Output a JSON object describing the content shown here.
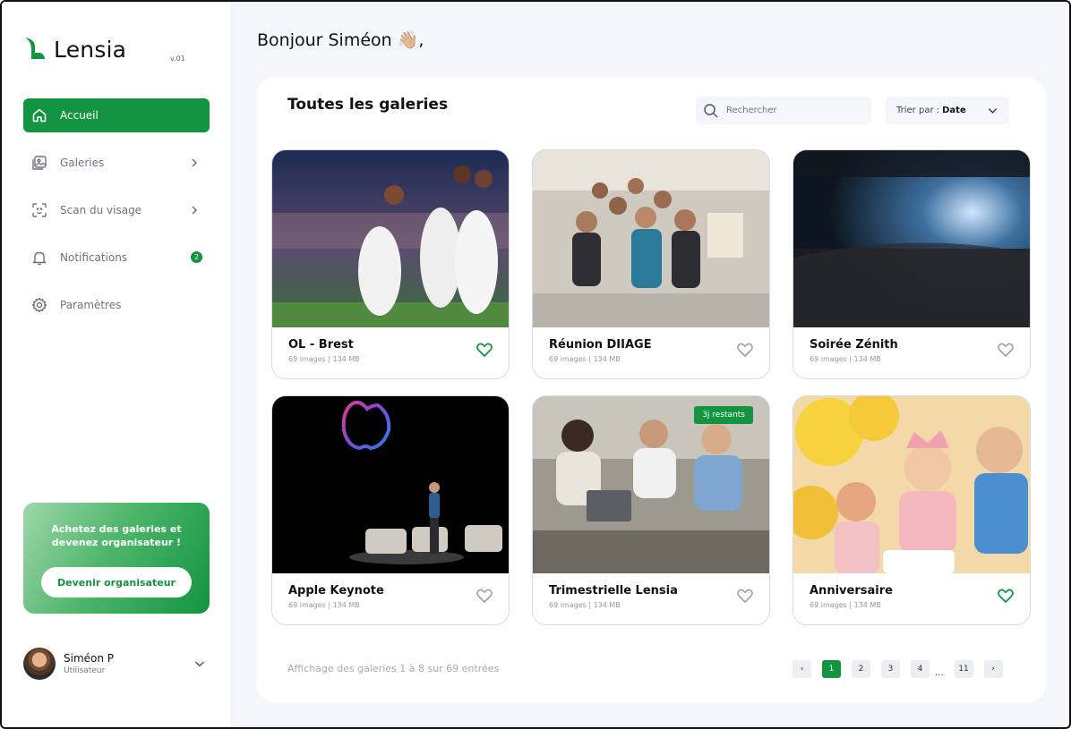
{
  "brand": {
    "name": "Lensia",
    "version": "v.01",
    "accent": "#129440"
  },
  "sidebar": {
    "items": [
      {
        "label": "Accueil",
        "icon": "home-icon",
        "active": true
      },
      {
        "label": "Galeries",
        "icon": "gallery-icon"
      },
      {
        "label": "Scan du visage",
        "icon": "face-scan-icon"
      },
      {
        "label": "Notifications",
        "icon": "bell-icon",
        "badge": "2"
      },
      {
        "label": "Paramètres",
        "icon": "gear-icon"
      }
    ],
    "promo": {
      "text": "Achetez des galeries et devenez organisateur !",
      "button": "Devenir organisateur"
    },
    "user": {
      "name": "Siméon P",
      "role": "Utilisateur"
    }
  },
  "header": {
    "greeting": "Bonjour Siméon 👋🏼,"
  },
  "main": {
    "title": "Toutes les galeries",
    "search": {
      "placeholder": "Rechercher"
    },
    "sort": {
      "label": "Trier par :",
      "value": "Date"
    },
    "galleries": [
      {
        "title": "OL - Brest",
        "meta": "69 images | 134 MB",
        "favorite": true
      },
      {
        "title": "Réunion DIIAGE",
        "meta": "69 images | 134 MB",
        "favorite": false
      },
      {
        "title": "Soirée Zénith",
        "meta": "69 images | 134 MB",
        "favorite": false
      },
      {
        "title": "Apple Keynote",
        "meta": "69 images | 134 MB",
        "favorite": false
      },
      {
        "title": "Trimestrielle Lensia",
        "meta": "69 images | 134 MB",
        "favorite": false,
        "badge": "3j restants"
      },
      {
        "title": "Anniversaire",
        "meta": "69 images | 134 MB",
        "favorite": true
      }
    ],
    "footer": {
      "summary": "Affichage des galeries 1 à 8 sur 69 entrées"
    },
    "pagination": {
      "prev": "‹",
      "pages": [
        "1",
        "2",
        "3",
        "4"
      ],
      "ellipsis": "...",
      "last": "11",
      "next": "›",
      "current": "1"
    }
  }
}
